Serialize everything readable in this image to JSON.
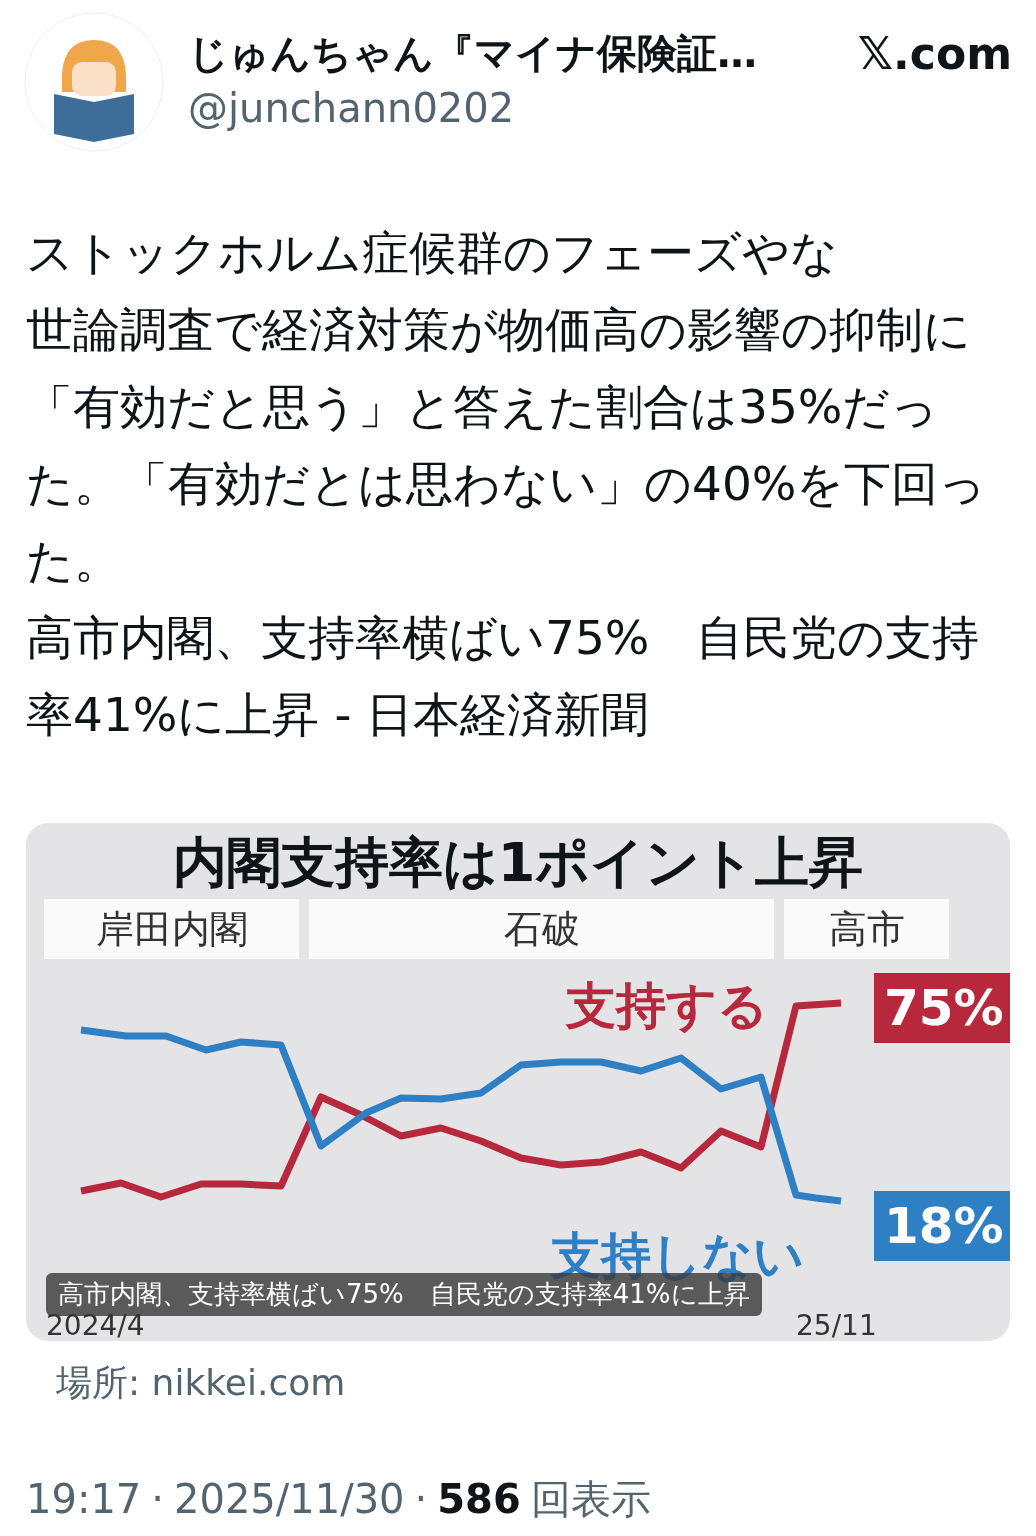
{
  "author": {
    "name": "じゅんちゃん『マイナ保険証…",
    "site": "𝕏.com",
    "handle": "@junchann0202"
  },
  "post": {
    "paragraphs": [
      "ストックホルム症候群のフェーズやな",
      "世論調査で経済対策が物価高の影響の抑制に「有効だと思う」と答えた割合は35%だった。「有効だとは思わない」の40%を下回った。",
      "高市内閣、支持率横ばい75%　自民党の支持率41%に上昇 - 日本経済新聞"
    ]
  },
  "card": {
    "title": "内閣支持率は1ポイント上昇",
    "eras": [
      {
        "label": "岸田内閣"
      },
      {
        "label": "石破"
      },
      {
        "label": "高市"
      }
    ],
    "series": [
      {
        "name": "支持する",
        "color": "#b8283c",
        "end_label": "75%"
      },
      {
        "name": "支持しない",
        "color": "#2e7fc4",
        "end_label": "18%"
      }
    ],
    "x_start": "2024/4",
    "x_end": "25/11",
    "caption": "高市内閣、支持率横ばい75%　自民党の支持率41%に上昇",
    "source": "場所: nikkei.com"
  },
  "meta": {
    "time": "19:17",
    "separator": "·",
    "date": "2025/11/30",
    "separator_2": "·",
    "views": "586",
    "views_label": "回表示"
  }
}
